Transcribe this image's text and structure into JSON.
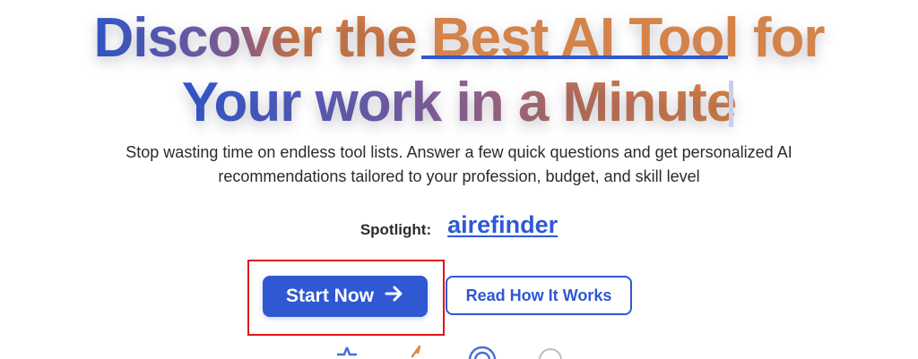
{
  "hero": {
    "line1_part1": "Discover the ",
    "line1_highlight": "Best AI Tool",
    "line1_part2": " for",
    "line2": "Your work in a Minute"
  },
  "subtitle": {
    "line1": "Stop wasting time on endless tool lists. Answer a few quick questions and get personalized AI",
    "line2": "recommendations tailored to your profession, budget, and skill level"
  },
  "spotlight": {
    "label": "Spotlight:",
    "link_text": "airefinder"
  },
  "buttons": {
    "primary_label": "Start Now",
    "primary_icon": "arrow-right-icon",
    "secondary_label": "Read How It Works"
  },
  "colors": {
    "brand_blue": "#2f58d2",
    "accent_orange": "#d4834a",
    "highlight_box": "#e0141a"
  },
  "feature_icons": [
    "star-icon",
    "lightning-icon",
    "target-icon",
    "circle-icon"
  ]
}
